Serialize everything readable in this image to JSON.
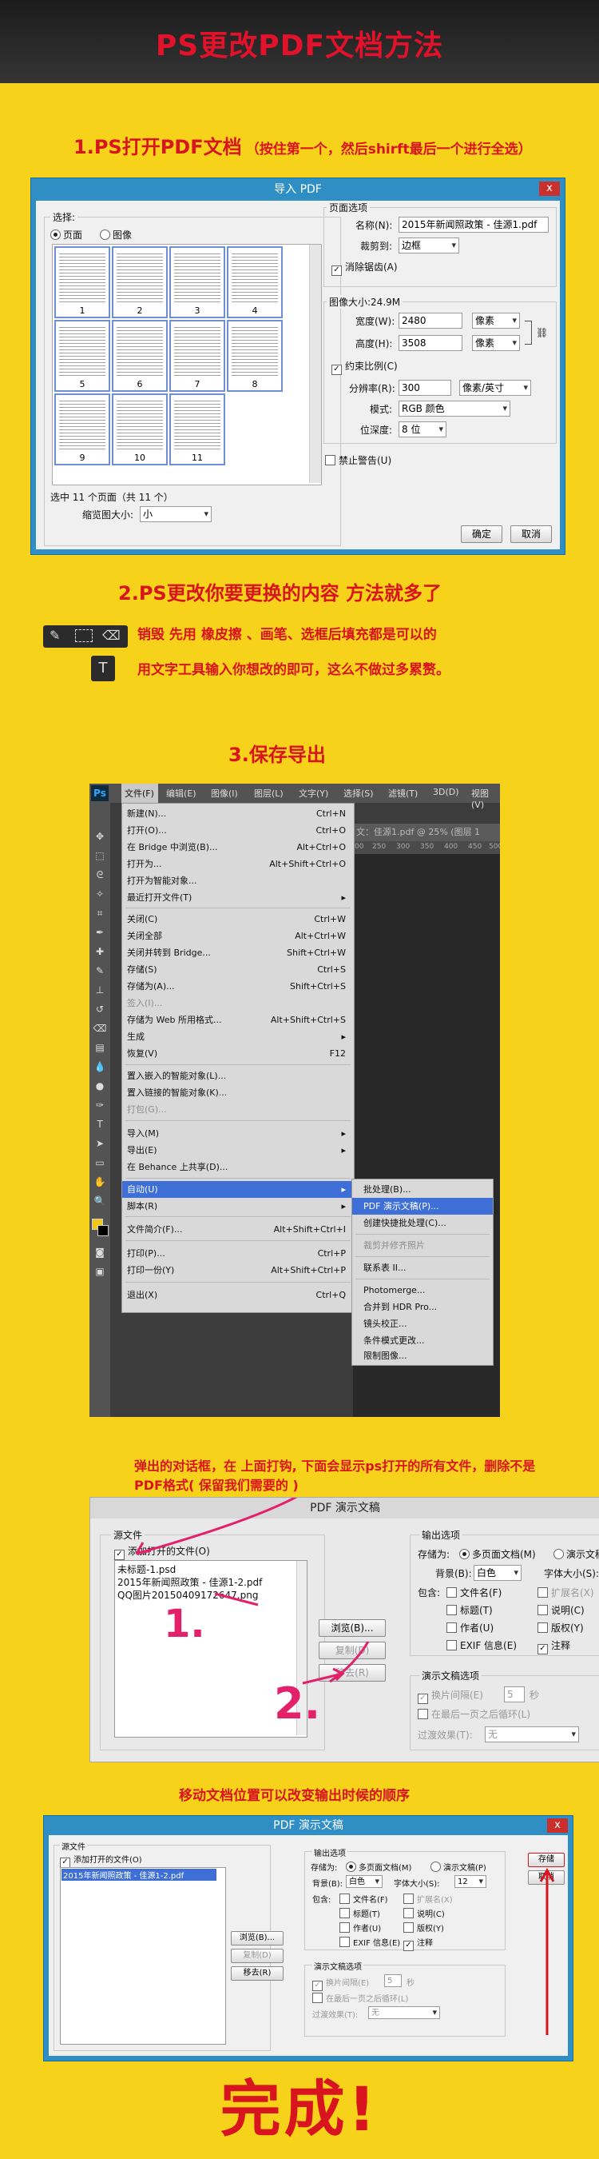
{
  "header": {
    "title": "PS更改PDF文档方法"
  },
  "step1": {
    "title": "1.PS打开PDF文档",
    "note": "（按住第一个，然后shirft最后一个进行全选）"
  },
  "step2": {
    "title": "2.PS更改你要更换的内容 方法就多了",
    "line1": "销毁   先用 橡皮擦 、画笔、选框后填充都是可以的",
    "line2": "用文字工具输入你想改的即可，这么不做过多累赘。"
  },
  "step3": {
    "title": "3.保存导出"
  },
  "import_dialog": {
    "title": "导入 PDF",
    "close": "x",
    "select_label": "选择:",
    "radio_page": "页面",
    "radio_image": "图像",
    "thumbs": [
      "1",
      "2",
      "3",
      "4",
      "5",
      "6",
      "7",
      "8",
      "9",
      "10",
      "11"
    ],
    "selected_info": "选中 11 个页面（共 11 个）",
    "thumb_size_label": "缩览图大小:",
    "thumb_size_value": "小",
    "page_options": "页面选项",
    "name_label": "名称(N):",
    "name_value": "2015年新闻照政策 - 佳源1.pdf",
    "crop_label": "裁剪到:",
    "crop_value": "边框",
    "antialias": "消除锯齿(A)",
    "image_size": "图像大小:24.9M",
    "width_label": "宽度(W):",
    "width_value": "2480",
    "height_label": "高度(H):",
    "height_value": "3508",
    "unit": "像素",
    "constrain": "约束比例(C)",
    "res_label": "分辨率(R):",
    "res_value": "300",
    "res_unit": "像素/英寸",
    "mode_label": "模式:",
    "mode_value": "RGB 颜色",
    "depth_label": "位深度:",
    "depth_value": "8 位",
    "suppress": "禁止警告(U)",
    "ok": "确定",
    "cancel": "取消"
  },
  "ps": {
    "logo": "Ps",
    "menubar": [
      "文件(F)",
      "编辑(E)",
      "图像(I)",
      "图层(L)",
      "文字(Y)",
      "选择(S)",
      "滤镜(T)",
      "3D(D)",
      "视图(V)"
    ],
    "doc_tab": "文：佳源1.pdf @ 25% (图层 1",
    "ruler": [
      "00",
      "250",
      "300",
      "350",
      "400",
      "450",
      "500"
    ],
    "file_menu": [
      {
        "t": "新建(N)...",
        "k": "Ctrl+N"
      },
      {
        "t": "打开(O)...",
        "k": "Ctrl+O"
      },
      {
        "t": "在 Bridge 中浏览(B)...",
        "k": "Alt+Ctrl+O"
      },
      {
        "t": "打开为...",
        "k": "Alt+Shift+Ctrl+O"
      },
      {
        "t": "打开为智能对象...",
        "k": ""
      },
      {
        "t": "最近打开文件(T)",
        "k": "▸"
      },
      {
        "t": "关闭(C)",
        "k": "Ctrl+W"
      },
      {
        "t": "关闭全部",
        "k": "Alt+Ctrl+W"
      },
      {
        "t": "关闭并转到 Bridge...",
        "k": "Shift+Ctrl+W"
      },
      {
        "t": "存储(S)",
        "k": "Ctrl+S"
      },
      {
        "t": "存储为(A)...",
        "k": "Shift+Ctrl+S"
      },
      {
        "t": "签入(I)...",
        "k": ""
      },
      {
        "t": "存储为 Web 所用格式...",
        "k": "Alt+Shift+Ctrl+S"
      },
      {
        "t": "生成",
        "k": "▸"
      },
      {
        "t": "恢复(V)",
        "k": "F12"
      },
      {
        "t": "置入嵌入的智能对象(L)...",
        "k": ""
      },
      {
        "t": "置入链接的智能对象(K)...",
        "k": ""
      },
      {
        "t": "打包(G)...",
        "k": ""
      },
      {
        "t": "导入(M)",
        "k": "▸"
      },
      {
        "t": "导出(E)",
        "k": "▸"
      },
      {
        "t": "在 Behance 上共享(D)...",
        "k": ""
      },
      {
        "t": "自动(U)",
        "k": "▸"
      },
      {
        "t": "脚本(R)",
        "k": "▸"
      },
      {
        "t": "文件简介(F)...",
        "k": "Alt+Shift+Ctrl+I"
      },
      {
        "t": "打印(P)...",
        "k": "Ctrl+P"
      },
      {
        "t": "打印一份(Y)",
        "k": "Alt+Shift+Ctrl+P"
      },
      {
        "t": "退出(X)",
        "k": "Ctrl+Q"
      }
    ],
    "auto_menu": [
      "批处理(B)...",
      "PDF 演示文稿(P)...",
      "创建快捷批处理(C)...",
      "裁剪并修齐照片",
      "联系表 II...",
      "Photomerge...",
      "合并到 HDR Pro...",
      "镜头校正...",
      "条件模式更改...",
      "限制图像..."
    ]
  },
  "note_red": "弹出的对话框，在 上面打钩, 下面会显示ps打开的所有文件，删除不是PDF格式( 保留我们需要的 )",
  "pdf_dialog": {
    "title": "PDF 演示文稿",
    "source_files": "源文件",
    "add_open": "添加打开的文件(O)",
    "files": [
      "未标题-1.psd",
      "2015年新闻照政策 - 佳源1-2.pdf",
      "QQ图片20150409172647.png"
    ],
    "browse": "浏览(B)...",
    "duplicate": "复制(D)",
    "remove": "移去(R)",
    "output_options": "输出选项",
    "save_as_label": "存储为:",
    "multi_page": "多页面文档(M)",
    "presentation": "演示文稿(P)",
    "bg_label": "背景(B):",
    "bg_value": "白色",
    "font_size_label": "字体大小(S):",
    "font_size_value": "12",
    "include_label": "包含:",
    "inc_filename": "文件名(F)",
    "inc_ext": "扩展名(X)",
    "inc_title": "标题(T)",
    "inc_desc": "说明(C)",
    "inc_author": "作者(U)",
    "inc_copyright": "版权(Y)",
    "inc_exif": "EXIF 信息(E)",
    "inc_notes": "注释",
    "pres_options": "演示文稿选项",
    "advance": "换片间隔(E)",
    "advance_value": "5",
    "seconds": "秒",
    "loop": "在最后一页之后循环(L)",
    "transition_label": "过渡效果(T):",
    "transition_value": "无",
    "save": "存储",
    "cancel": "取消",
    "handwriting1": "1.",
    "handwriting2": "2."
  },
  "note_move": "移动文档位置可以改变输出时候的顺序",
  "pdf_dialog2": {
    "files": [
      "2015年新闻照政策 - 佳源1-2.pdf"
    ]
  },
  "done": "完成!"
}
